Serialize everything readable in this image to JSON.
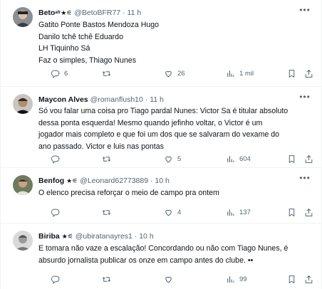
{
  "tweets": [
    {
      "display_name": "Beto",
      "name_suffix": "ᵃᶠʳ★⚟",
      "handle": "@BetoBFR77",
      "separator": "·",
      "time": "11 h",
      "lines": [
        "Gatito Ponte Bastos Mendoza Hugo",
        "Danilo tchê tchê Eduardo",
        "LH Tiquinho Sá",
        "Faz o simples, Thiago Nunes"
      ],
      "replies": "6",
      "retweets": "",
      "likes": "26",
      "views": "1 mil"
    },
    {
      "display_name": "Maycon Alves",
      "name_suffix": "",
      "handle": "@romanflush10",
      "separator": "·",
      "time": "11 h",
      "lines": [
        "Só vou falar uma coisa pro Tiago pardal Nunes: Victor Sa é titular absoluto",
        "dessa ponta esquerda! Mesmo quando jefinho voltar, o Victor é um",
        "jogador mais completo e que foi um dos que se salvaram do vexame do",
        "ano passado. Victor e luis nas pontas"
      ],
      "replies": "",
      "retweets": "",
      "likes": "5",
      "views": "604"
    },
    {
      "display_name": "Benfog",
      "name_suffix": "★⚟",
      "handle": "@Leonard62773889",
      "separator": "·",
      "time": "10 h",
      "lines": [
        "O elenco precisa reforçar o meio de campo pra ontem"
      ],
      "replies": "",
      "retweets": "",
      "likes": "4",
      "views": "137"
    },
    {
      "display_name": "Biriba",
      "name_suffix": "★⚟",
      "handle": "@ubiratanayres1",
      "separator": "·",
      "time": "10 h",
      "lines": [
        "E tomara não vaze a escalação! Concordando ou não com Tiago Nunes, é",
        "absurdo jornalista publicar os onze em campo antes do clube. ••"
      ],
      "replies": "",
      "retweets": "",
      "likes": "",
      "views": "99"
    }
  ],
  "icons": {
    "more": "more-horizontal-icon",
    "reply": "reply-icon",
    "retweet": "retweet-icon",
    "like": "heart-icon",
    "views": "views-chart-icon",
    "bookmark": "bookmark-icon",
    "share": "share-icon"
  },
  "colors": {
    "text": "#0f1419",
    "muted": "#536471",
    "divider": "#eff3f4"
  }
}
